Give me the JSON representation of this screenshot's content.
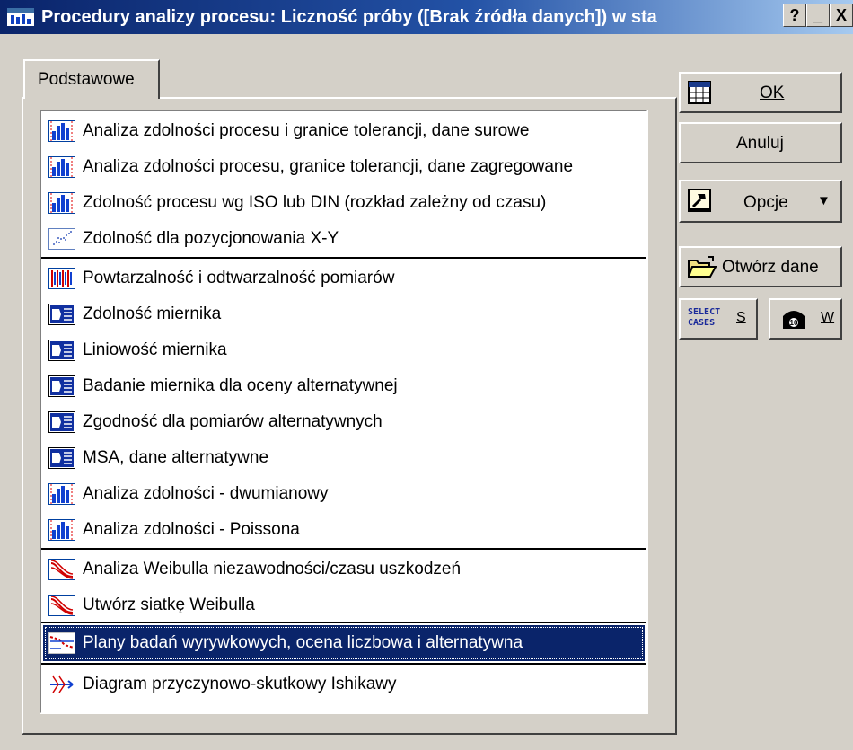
{
  "window": {
    "title": "Procedury analizy procesu: Liczność próby ([Brak źródła danych]) w sta",
    "help_label": "?",
    "minimize_label": "_",
    "close_label": "X"
  },
  "tabs": [
    {
      "label": "Podstawowe"
    }
  ],
  "procedures": [
    {
      "label": "Analiza zdolności procesu i granice tolerancji, dane surowe",
      "icon": "histogram-icon"
    },
    {
      "label": "Analiza zdolności procesu, granice tolerancji, dane zagregowane",
      "icon": "histogram-icon"
    },
    {
      "label": "Zdolność procesu wg ISO lub DIN (rozkład zależny od czasu)",
      "icon": "histogram-icon"
    },
    {
      "label": "Zdolność dla pozycjonowania X-Y",
      "icon": "scatter-icon"
    },
    {
      "label": "Powtarzalność i odtwarzalność pomiarów",
      "icon": "repeatability-icon"
    },
    {
      "label": "Zdolność miernika",
      "icon": "gauge-icon"
    },
    {
      "label": "Liniowość miernika",
      "icon": "gauge-icon"
    },
    {
      "label": "Badanie miernika dla oceny alternatywnej",
      "icon": "gauge-icon"
    },
    {
      "label": "Zgodność dla pomiarów alternatywnych",
      "icon": "gauge-icon"
    },
    {
      "label": "MSA, dane alternatywne",
      "icon": "gauge-icon"
    },
    {
      "label": "Analiza zdolności - dwumianowy",
      "icon": "histogram-icon"
    },
    {
      "label": "Analiza zdolności - Poissona",
      "icon": "histogram-icon"
    },
    {
      "label": "Analiza Weibulla niezawodności/czasu uszkodzeń",
      "icon": "weibull-icon"
    },
    {
      "label": "Utwórz siatkę Weibulla",
      "icon": "weibull-icon"
    },
    {
      "label": "Plany badań wyrywkowych, ocena liczbowa i alternatywna",
      "icon": "sampling-plan-icon",
      "selected": true
    },
    {
      "label": "Diagram przyczynowo-skutkowy Ishikawy",
      "icon": "fishbone-icon"
    }
  ],
  "buttons": {
    "ok": "OK",
    "cancel": "Anuluj",
    "options": "Opcje",
    "open_data": "Otwórz dane",
    "select_cases_top": "SELECT",
    "select_cases_bottom": "CASES",
    "select_cases_key": "S",
    "weight_key": "W"
  },
  "colors": {
    "selection": "#0a246a",
    "title_start": "#0a246a",
    "title_end": "#a6caf0",
    "face": "#d4d0c8"
  }
}
